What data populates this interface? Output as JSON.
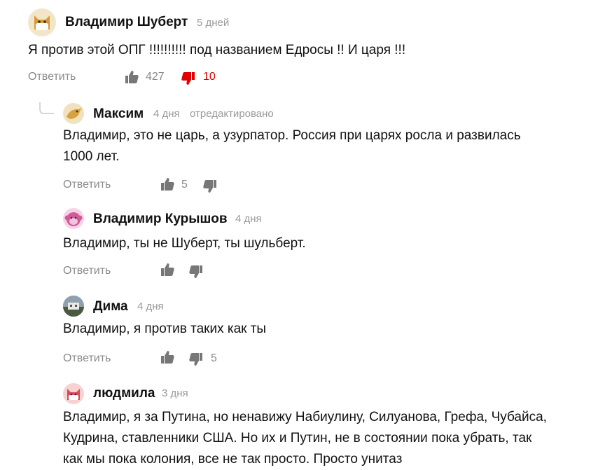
{
  "comments": [
    {
      "author": "Владимир Шуберт",
      "time": "5 дней",
      "edited": "",
      "text": "Я против этой ОПГ !!!!!!!!!! под названием Едросы !! И царя !!!",
      "reply": "Ответить",
      "likes": "427",
      "dislikes": "10",
      "avatar": "cat-mask-avatar"
    },
    {
      "author": "Максим",
      "time": "4 дня",
      "edited": "отредактировано",
      "text": "Владимир, это не царь, а узурпатор. Россия при царях росла и развилась 1000 лет.",
      "reply": "Ответить",
      "likes": "5",
      "dislikes": "",
      "avatar": "bird-avatar"
    },
    {
      "author": "Владимир Курышов",
      "time": "4 дня",
      "edited": "",
      "text": "Владимир, ты не Шуберт, ты шульберт.",
      "reply": "Ответить",
      "likes": "",
      "dislikes": "",
      "avatar": "monkey-avatar"
    },
    {
      "author": "Дима",
      "time": "4 дня",
      "edited": "",
      "text": "Владимир, я против таких как ты",
      "reply": "Ответить",
      "likes": "",
      "dislikes": "5",
      "avatar": "photo-avatar"
    },
    {
      "author": "людмила",
      "time": "3 дня",
      "edited": "",
      "text": "Владимир, я за Путина, но ненавижу Набиулину, Силуанова, Грефа, Чубайса, Кудрина, ставленники США. Но их и Путин, не в состоянии пока убрать, так как мы пока колония, все не так просто. Просто унитаз",
      "avatar": "cat-pink-avatar"
    }
  ],
  "colors": {
    "accent_red": "#e00000",
    "muted": "#8a8a8a",
    "icon": "#777777"
  }
}
